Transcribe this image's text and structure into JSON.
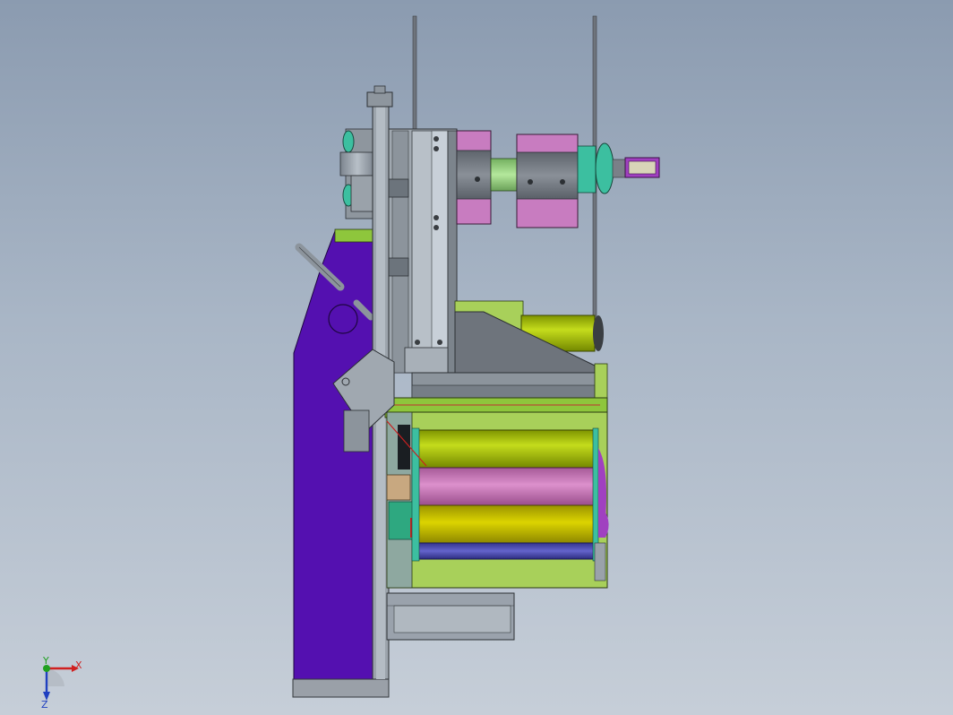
{
  "triad": {
    "x_label": "X",
    "y_label": "Y",
    "z_label": "Z"
  },
  "colors": {
    "background_top": "#8b9bb0",
    "background_bottom": "#c6ced8",
    "frame_purple": "#5410b0",
    "roller_lime": "#a8c400",
    "roller_pink": "#c874b8",
    "roller_yellow": "#c8c000",
    "roller_blue": "#4a4ab8",
    "frame_green": "#a8d05a",
    "steel_gray": "#9aa2ac",
    "teal_part": "#3cbfa0",
    "magenta_part": "#a040c0"
  }
}
